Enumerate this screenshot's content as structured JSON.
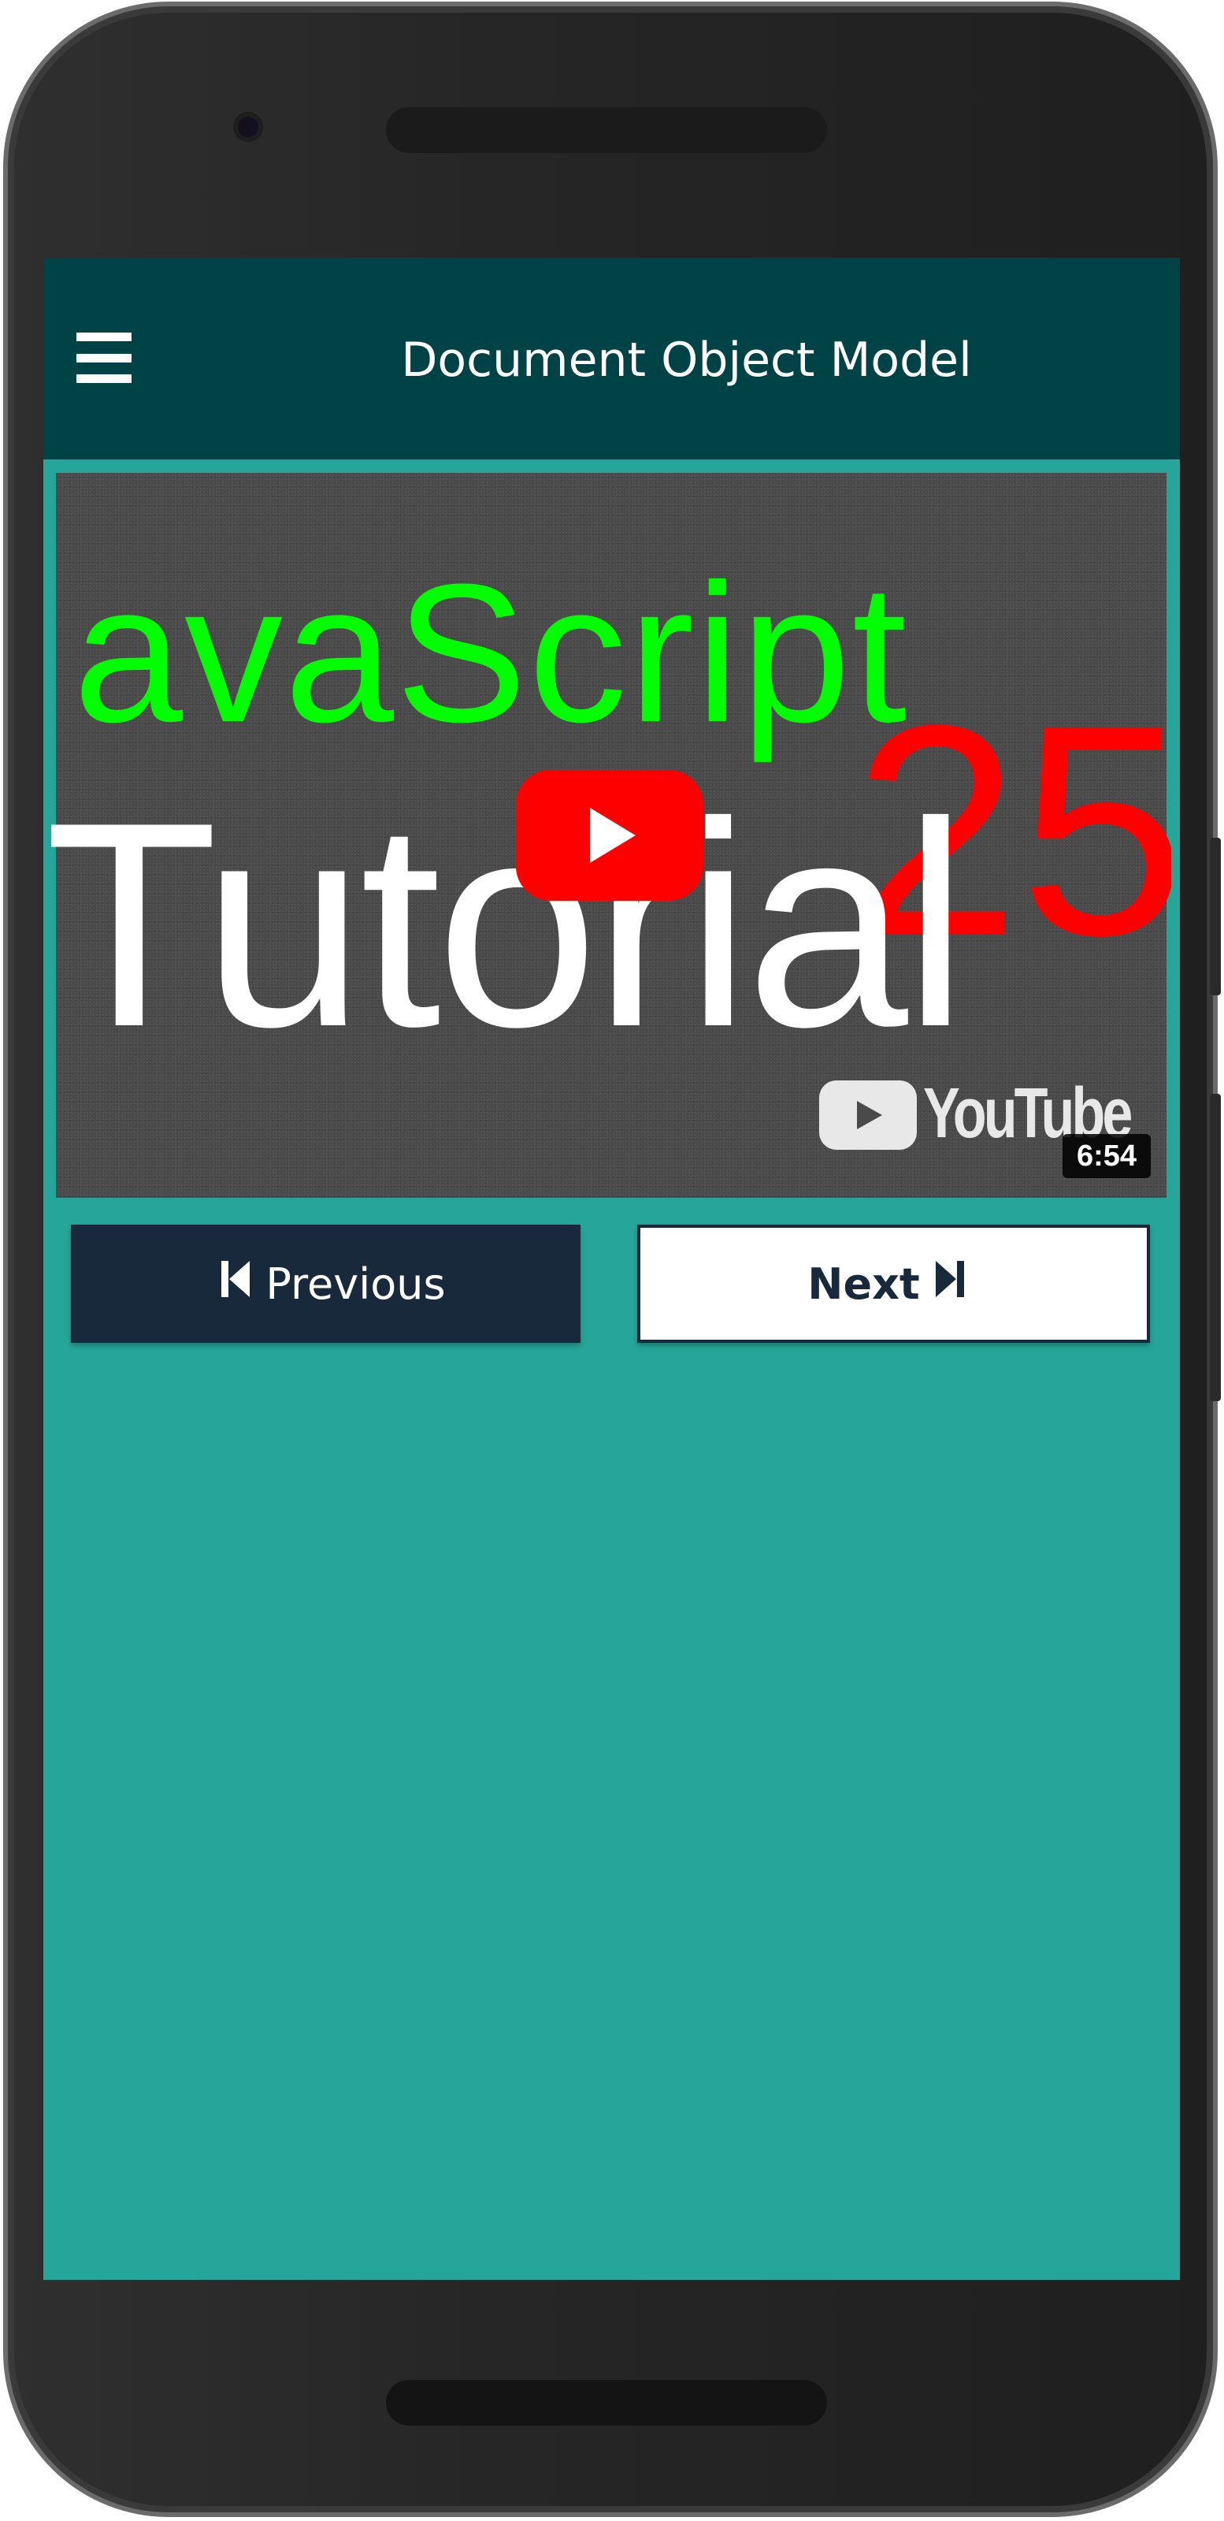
{
  "appbar": {
    "title": "Document Object Model",
    "menu_icon": "hamburger-menu-icon"
  },
  "video": {
    "thumbnail_line1": "avaScript",
    "thumbnail_line2": "Tutorial",
    "thumbnail_number": "25",
    "play_icon": "play-icon",
    "brand": "YouTube",
    "duration": "6:54"
  },
  "navigation": {
    "previous_label": "Previous",
    "previous_icon": "skip-previous-icon",
    "next_label": "Next",
    "next_icon": "skip-next-icon"
  },
  "colors": {
    "appbar_bg": "#004346",
    "screen_bg": "#26a69a",
    "previous_bg": "#17293a",
    "next_bg": "#ffffff",
    "youtube_red": "#ff0000",
    "thumbnail_green": "#00ff00"
  }
}
